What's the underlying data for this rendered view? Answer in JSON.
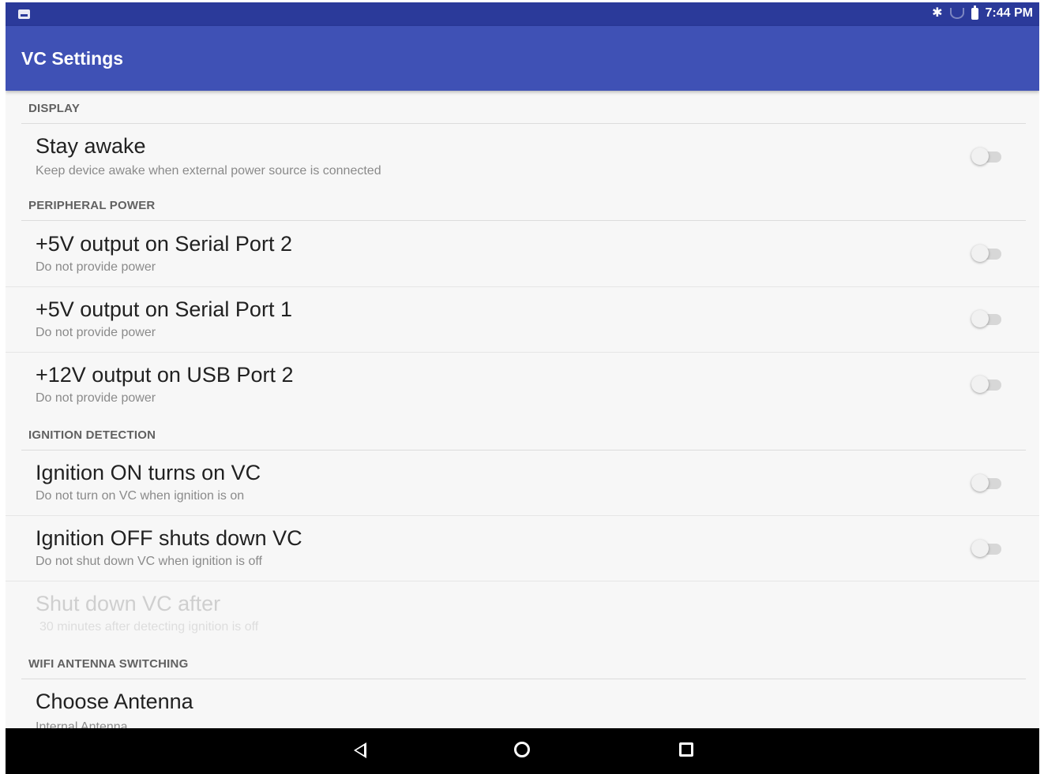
{
  "status_bar": {
    "time": "7:44 PM",
    "icons": [
      "notification-icon",
      "bluetooth-icon",
      "wifi-icon",
      "battery-icon"
    ]
  },
  "app_bar": {
    "title": "VC Settings",
    "color": "#3f51b5",
    "status_color": "#2b3a9a"
  },
  "sections": {
    "display": "DISPLAY",
    "peripheral_power": "PERIPHERAL POWER",
    "ignition_detection": "IGNITION DETECTION",
    "wifi_antenna": "WIFI ANTENNA SWITCHING"
  },
  "prefs": {
    "stay_awake": {
      "title": "Stay awake",
      "summary": "Keep device awake when external power source is connected",
      "enabled": false
    },
    "serial2": {
      "title": "+5V output on Serial Port 2",
      "summary": "Do not provide power",
      "enabled": false
    },
    "serial1": {
      "title": "+5V output on Serial Port 1",
      "summary": "Do not provide power",
      "enabled": false
    },
    "usb2": {
      "title": "+12V output on USB Port 2",
      "summary": "Do not provide power",
      "enabled": false
    },
    "ign_on": {
      "title": "Ignition ON turns on VC",
      "summary": "Do not turn on VC when ignition is on",
      "enabled": false
    },
    "ign_off": {
      "title": "Ignition OFF shuts down VC",
      "summary": "Do not shut down VC when ignition is off",
      "enabled": false
    },
    "shutdown_after": {
      "title": "Shut down VC after",
      "summary": "30 minutes after detecting ignition is off",
      "disabled": true
    },
    "antenna": {
      "title": "Choose Antenna",
      "summary": "Internal Antenna"
    }
  },
  "nav_bar": {
    "buttons": [
      "back-icon",
      "home-icon",
      "recents-icon"
    ]
  }
}
